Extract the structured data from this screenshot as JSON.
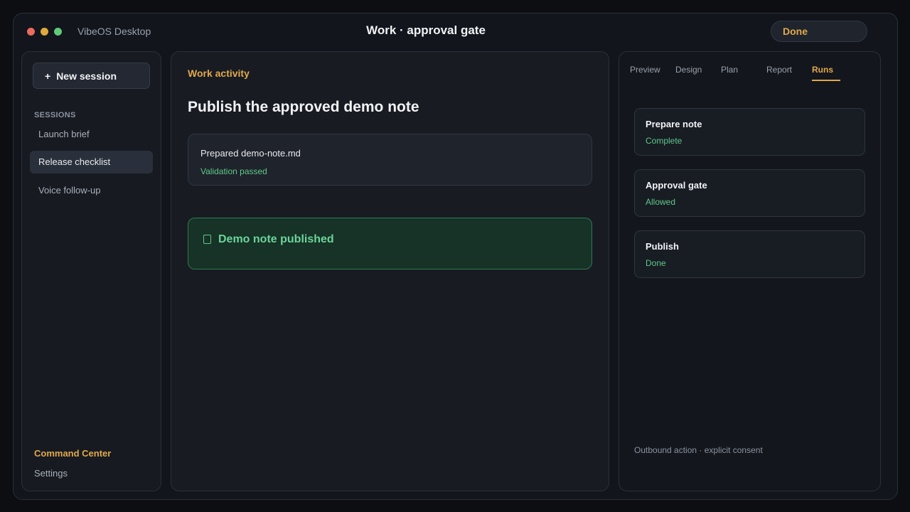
{
  "app": {
    "name": "VibeOS Desktop",
    "window_title": "Work · approval gate",
    "status": "Done",
    "colors": {
      "accent": "#e1a94a",
      "success": "#5fc98a",
      "traffic_close": "#ec6a5e",
      "traffic_minimize": "#e0a93c",
      "traffic_zoom": "#5fc97a"
    }
  },
  "sidebar": {
    "new_session": {
      "icon": "plus-icon",
      "plus": "+",
      "label": "New session"
    },
    "sessions_label": "SESSIONS",
    "sessions": [
      {
        "label": "Launch brief",
        "active": false
      },
      {
        "label": "Release checklist",
        "active": true
      },
      {
        "label": "Voice follow-up",
        "active": false
      }
    ],
    "command_center": "Command Center",
    "settings": "Settings"
  },
  "main": {
    "section_label": "Work activity",
    "heading": "Publish the approved demo note",
    "artifact": {
      "name": "Prepared demo-note.md",
      "status": "Validation passed"
    },
    "success": {
      "icon": "document-check-icon",
      "text": "Demo note published"
    }
  },
  "right_panel": {
    "tabs": [
      {
        "label": "Preview",
        "active": false
      },
      {
        "label": "Design",
        "active": false
      },
      {
        "label": "Plan",
        "active": false
      },
      {
        "label": "Report",
        "active": false
      },
      {
        "label": "Runs",
        "active": true
      }
    ],
    "runs": [
      {
        "title": "Prepare note",
        "status": "Complete"
      },
      {
        "title": "Approval gate",
        "status": "Allowed"
      },
      {
        "title": "Publish",
        "status": "Done"
      }
    ],
    "footer": "Outbound action · explicit consent"
  }
}
